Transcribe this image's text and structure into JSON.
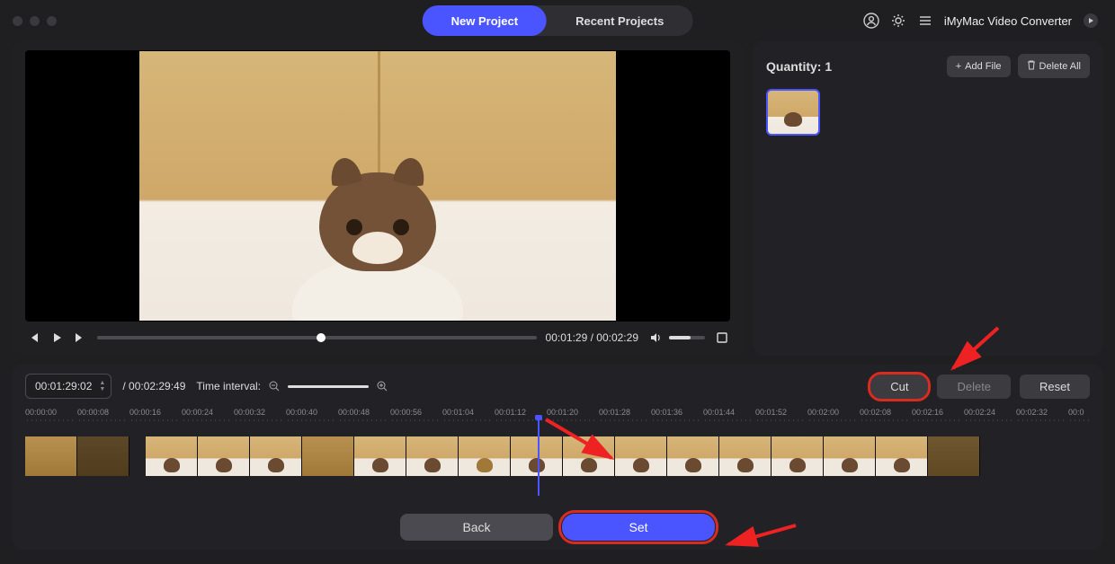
{
  "header": {
    "tab_new": "New Project",
    "tab_recent": "Recent Projects",
    "app_name": "iMyMac Video Converter"
  },
  "preview": {
    "time_current": "00:01:29",
    "time_total": "00:02:29",
    "seek_percent": 50
  },
  "side": {
    "quantity_label": "Quantity:",
    "quantity_value": "1",
    "add_file": "Add File",
    "delete_all": "Delete All"
  },
  "editor": {
    "timecode_in": "00:01:29:02",
    "timecode_total": "00:02:29:49",
    "time_interval_label": "Time interval:",
    "cut": "Cut",
    "delete": "Delete",
    "reset": "Reset",
    "back": "Back",
    "set": "Set",
    "ruler": [
      "00:00:00",
      "00:00:08",
      "00:00:16",
      "00:00:24",
      "00:00:32",
      "00:00:40",
      "00:00:48",
      "00:00:56",
      "00:01:04",
      "00:01:12",
      "00:01:20",
      "00:01:28",
      "00:01:36",
      "00:01:44",
      "00:01:52",
      "00:02:00",
      "00:02:08",
      "00:02:16",
      "00:02:24",
      "00:02:32",
      "00:0"
    ]
  },
  "annotations": {
    "arrow_to_cut": true,
    "arrow_to_playhead": true,
    "arrow_to_set": true
  }
}
